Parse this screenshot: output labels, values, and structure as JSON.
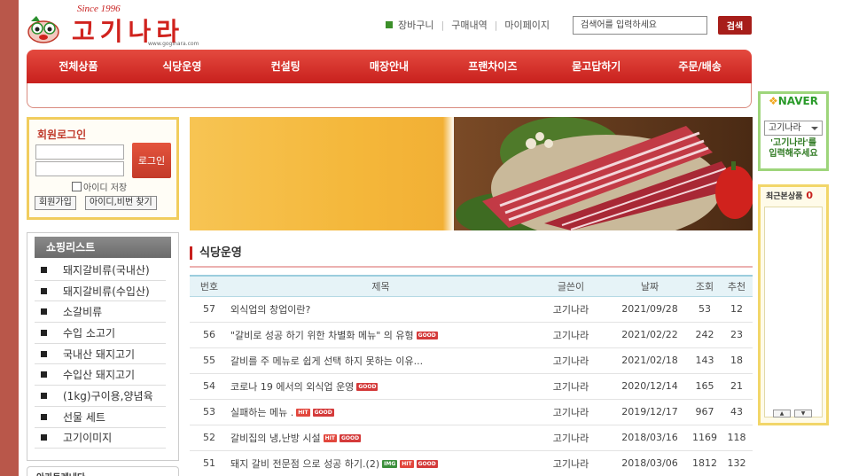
{
  "header": {
    "since": "Since 1996",
    "logo_text": "고기나라",
    "logo_url": "www.goginara.com",
    "top_links": [
      "장바구니",
      "구매내역",
      "마이페이지"
    ],
    "search_placeholder": "검색어를 입력하세요",
    "search_button": "검색"
  },
  "nav": [
    "전체상품",
    "식당운영",
    "컨설팅",
    "매장안내",
    "프랜차이즈",
    "묻고답하기",
    "주문/배송"
  ],
  "login": {
    "title": "회원로그인",
    "button": "로그인",
    "save_id": "아이디 저장",
    "join": "회원가입",
    "find": "아이디,비번 찾기"
  },
  "shop_list": {
    "title": "쇼핑리스트",
    "items": [
      "돼지갈비류(국내산)",
      "돼지갈비류(수입산)",
      "소갈비류",
      "수입 소고기",
      "국내산 돼지고기",
      "수입산 돼지고기",
      "(1kg)구이용,양념육",
      "선물 세트",
      "고기이미지"
    ]
  },
  "bottom_box": "아카트레내다",
  "board": {
    "title": "식당운영",
    "columns": [
      "번호",
      "제목",
      "글쓴이",
      "날짜",
      "조회",
      "추천"
    ],
    "rows": [
      {
        "num": "57",
        "title": "외식업의 창업이란?",
        "tags": [],
        "author": "고기나라",
        "date": "2021/09/28",
        "views": "53",
        "rec": "12"
      },
      {
        "num": "56",
        "title": "\"갈비로 성공 하기 위한 차별화 메뉴\" 의 유형",
        "tags": [
          "GOOD"
        ],
        "author": "고기나라",
        "date": "2021/02/22",
        "views": "242",
        "rec": "23"
      },
      {
        "num": "55",
        "title": "갈비를 주 메뉴로 쉽게 선택 하지 못하는 이유...",
        "tags": [],
        "author": "고기나라",
        "date": "2021/02/18",
        "views": "143",
        "rec": "18"
      },
      {
        "num": "54",
        "title": "코로나 19 에서의 외식업 운영",
        "tags": [
          "GOOD"
        ],
        "author": "고기나라",
        "date": "2020/12/14",
        "views": "165",
        "rec": "21"
      },
      {
        "num": "53",
        "title": "실패하는 메뉴 .",
        "tags": [
          "HIT",
          "GOOD"
        ],
        "author": "고기나라",
        "date": "2019/12/17",
        "views": "967",
        "rec": "43"
      },
      {
        "num": "52",
        "title": "갈비집의 냉,난방 시설",
        "tags": [
          "HIT",
          "GOOD"
        ],
        "author": "고기나라",
        "date": "2018/03/16",
        "views": "1169",
        "rec": "118"
      },
      {
        "num": "51",
        "title": "돼지 갈비 전문점 으로 성공 하기.(2)",
        "tags": [
          "IMG",
          "HIT",
          "GOOD"
        ],
        "author": "고기나라",
        "date": "2018/03/06",
        "views": "1812",
        "rec": "132"
      }
    ]
  },
  "naver": {
    "logo": "NAVER",
    "select_value": "고기나라",
    "hint_line1": "'고기나라'를",
    "hint_line2": "입력해주세요"
  },
  "recent": {
    "title": "최근본상품",
    "count": "0"
  },
  "colors": {
    "brand_red": "#c8201d",
    "brand_green": "#2a8f2d",
    "background": "#b9574a"
  }
}
